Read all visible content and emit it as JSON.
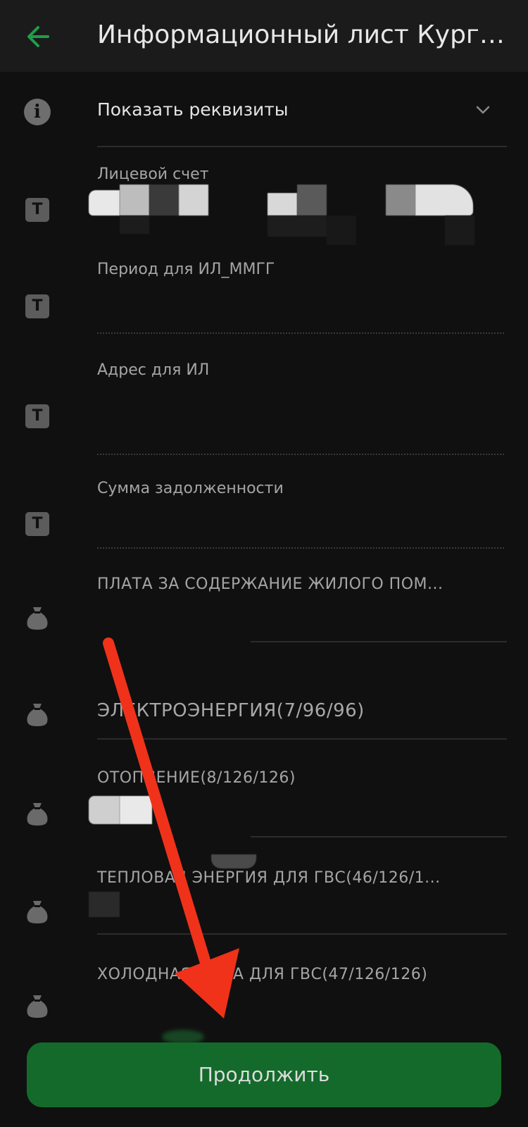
{
  "header": {
    "title": "Информационный лист Курга...",
    "back_icon": "arrow-left-icon",
    "accent_color": "#1f9d4a"
  },
  "requisites": {
    "toggle_label": "Показать реквизиты",
    "icon": "info-icon"
  },
  "fields": [
    {
      "label": "Лицевой счет",
      "icon": "text-field-icon"
    },
    {
      "label": "Период для ИЛ_ММГГ",
      "icon": "text-field-icon"
    },
    {
      "label": "Адрес для ИЛ",
      "icon": "text-field-icon"
    },
    {
      "label": "Сумма задолженности",
      "icon": "text-field-icon"
    }
  ],
  "services": [
    {
      "label": "ПЛАТА ЗА СОДЕРЖАНИЕ ЖИЛОГО ПОМ...",
      "icon": "money-bag-icon"
    },
    {
      "label": "ЭЛЕКТРОЭНЕРГИЯ(7/96/96)",
      "icon": "money-bag-icon"
    },
    {
      "label": "ОТОПЛЕНИЕ(8/126/126)",
      "icon": "money-bag-icon"
    },
    {
      "label": "ТЕПЛОВАЯ ЭНЕРГИЯ ДЛЯ ГВС(46/126/1...",
      "icon": "money-bag-icon"
    },
    {
      "label": "ХОЛОДНАЯ ВОДА ДЛЯ ГВС(47/126/126)",
      "icon": "money-bag-icon"
    }
  ],
  "footer": {
    "continue_label": "Продолжить",
    "button_color": "#146a2b"
  },
  "annotation": {
    "arrow_color": "#f0321a"
  }
}
